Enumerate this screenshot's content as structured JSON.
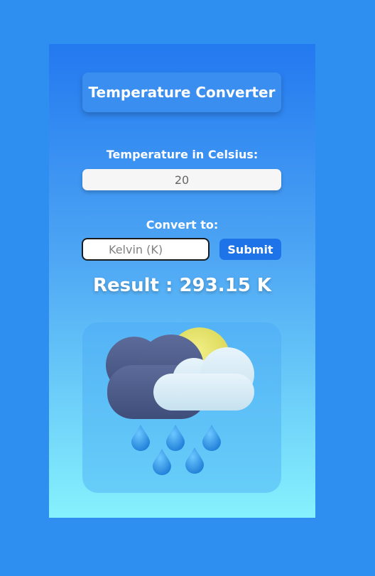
{
  "app": {
    "title": "Temperature Converter"
  },
  "celsius": {
    "label": "Temperature in Celsius:",
    "value": "20"
  },
  "convert": {
    "label": "Convert to:",
    "selected": "Kelvin (K)",
    "submit_label": "Submit"
  },
  "result": {
    "text": "Result : 293.15 K"
  },
  "illustration": {
    "icon": "rain-cloud-sun-icon"
  },
  "colors": {
    "background": "#2f8ff0",
    "card_top": "#2379ef",
    "card_bottom": "#86f1fd",
    "button": "#1f73e8"
  }
}
